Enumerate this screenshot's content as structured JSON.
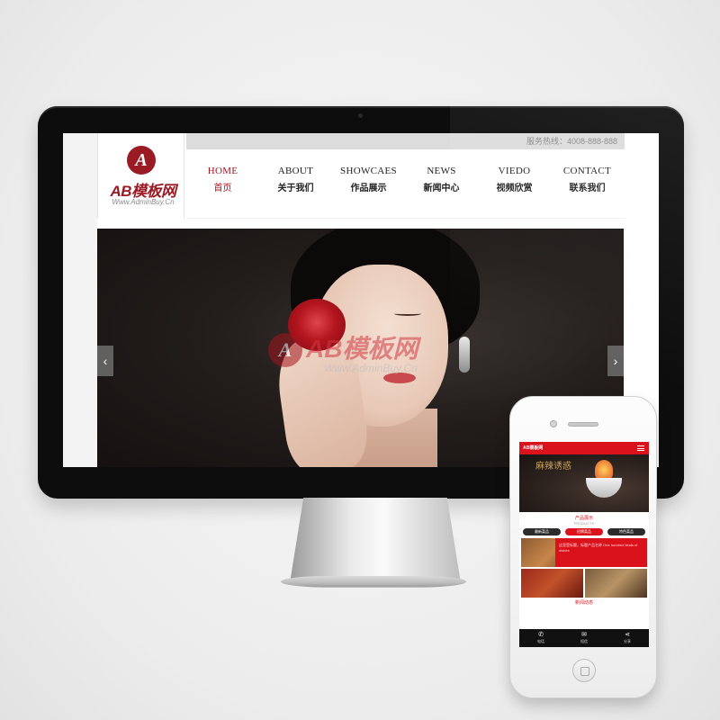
{
  "desktop": {
    "hotline": "服务热线：4008-888-888",
    "logo": {
      "mark": "A",
      "text": "AB模板网",
      "url": "Www.AdminBuy.Cn"
    },
    "nav": [
      {
        "en": "HOME",
        "cn": "首页",
        "active": true
      },
      {
        "en": "ABOUT",
        "cn": "关于我们",
        "active": false
      },
      {
        "en": "SHOWCAES",
        "cn": "作品展示",
        "active": false
      },
      {
        "en": "NEWS",
        "cn": "新闻中心",
        "active": false
      },
      {
        "en": "VIEDO",
        "cn": "视频欣赏",
        "active": false
      },
      {
        "en": "CONTACT",
        "cn": "联系我们",
        "active": false
      }
    ],
    "banner": {
      "watermark_mark": "A",
      "watermark_text": "AB模板网",
      "watermark_url": "Www.AdminBuy.Cn",
      "prev_icon": "chevron-left-icon",
      "next_icon": "chevron-right-icon",
      "prev_glyph": "‹",
      "next_glyph": "›"
    }
  },
  "mobile": {
    "header_logo": "AB模板网",
    "banner_text": "麻辣诱惑",
    "section_title": "产品展示",
    "section_sub": "PRODUCTS",
    "tabs": [
      {
        "label": "最新菜品",
        "active": false
      },
      {
        "label": "招牌菜品",
        "active": true
      },
      {
        "label": "特色菜品",
        "active": false
      }
    ],
    "overlay_text": "这里是标题，标题产品名称 One hundred kinds of dishes",
    "section2_title": "新闻动态",
    "footer": [
      {
        "icon": "phone-icon",
        "glyph": "✆",
        "label": "电话"
      },
      {
        "icon": "message-icon",
        "glyph": "✉",
        "label": "短信"
      },
      {
        "icon": "share-icon",
        "glyph": "⋖",
        "label": "分享"
      }
    ]
  },
  "colors": {
    "brand_red": "#a3151f",
    "mobile_red": "#d9121c",
    "monitor_bezel": "#0d0d0d"
  }
}
